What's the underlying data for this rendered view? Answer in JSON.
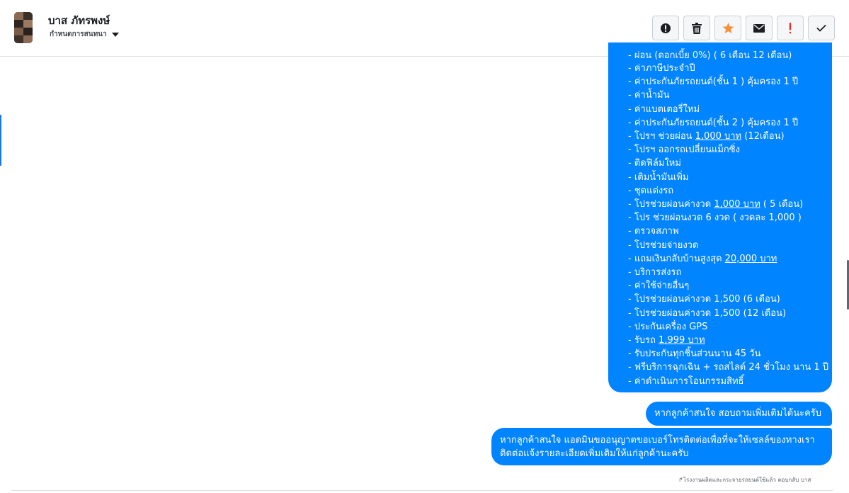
{
  "header": {
    "contact_name": "บาส ภัทรพงษ์",
    "assign_label": "กำหนดการสนทนา"
  },
  "toolbar": [
    {
      "name": "alert-circle-icon",
      "color": "#1c1e21"
    },
    {
      "name": "trash-icon",
      "color": "#1c1e21"
    },
    {
      "name": "star-icon",
      "color": "#f7923b"
    },
    {
      "name": "envelope-icon",
      "color": "#1c1e21"
    },
    {
      "name": "exclamation-icon",
      "color": "#e02e2e"
    },
    {
      "name": "check-icon",
      "color": "#1c1e21"
    }
  ],
  "message1": {
    "cut_line": "- ผ่อน (ดอกเบี้ย 0%) ( 6 เดือน 12 เดือน)",
    "items": [
      {
        "pre": "- ค่าภาษีประจำปี"
      },
      {
        "pre": "- ค่าประกันภัยรถยนต์(ชั้น 1 ) คุ้มครอง 1 ปี"
      },
      {
        "pre": "- ค่าน้ำมัน"
      },
      {
        "pre": "- ค่าแบตเตอรี่ใหม่"
      },
      {
        "pre": "- ค่าประกันภัยรถยนต์(ชั้น 2 ) คุ้มครอง 1 ปี"
      },
      {
        "pre": "- โปรฯ ช่วยผ่อน ",
        "link": "1,000 บาท",
        "post": " (12เดือน)"
      },
      {
        "pre": "- โปรฯ ออกรถเปลี่ยนแม็กซิ่ง"
      },
      {
        "pre": "- ติดฟิล์มใหม่"
      },
      {
        "pre": "- เติมน้ำมันเพิ่ม"
      },
      {
        "pre": "- ชุดแต่งรถ"
      },
      {
        "pre": "- โปรช่วยผ่อนค่างวด ",
        "link": "1,000 บาท",
        "post": " ( 5 เดือน)"
      },
      {
        "pre": "- โปร ช่วยผ่อนงวด 6 งวด ( งวดละ 1,000 )"
      },
      {
        "pre": "- ตรวจสภาพ"
      },
      {
        "pre": "- โปรช่วยจ่ายงวด"
      },
      {
        "pre": "- แถมเงินกลับบ้านสูงสุด ",
        "link": "20,000 บาท"
      },
      {
        "pre": "- บริการส่งรถ"
      },
      {
        "pre": "- ค่าใช้จ่ายอื่นๆ"
      },
      {
        "pre": "- โปรช่วยผ่อนค่างวด 1,500 (6 เดือน)"
      },
      {
        "pre": "- โปรช่วยผ่อนค่างวด 1,500 (12 เดือน)"
      },
      {
        "pre": "- ประกันเครื่อง GPS"
      },
      {
        "pre": "- รับรถ ",
        "link": "1,999 บาท"
      },
      {
        "pre": "- รับประกันทุกชิ้นส่วนนาน 45 วัน"
      },
      {
        "pre": "- ฟรีบริการฉุกเฉิน + รถสไลด์ 24 ชั่วโมง นาน 1 ปี"
      },
      {
        "pre": "- ค่าดำเนินการโอนกรรมสิทธิ์"
      }
    ]
  },
  "message2": "หากลูกค้าสนใจ สอบถามเพิ่มเติมได้นะครับ",
  "message3": {
    "line1": "หากลูกค้าสนใจ แอดมินขออนุญาตขอเบอร์โทรติดต่อเพื่อที่จะให้เซลล์ของทางเรา",
    "line2": "ติดต่อแจ้งรายละเอียดเพิ่มเติมให้แก่ลูกค้านะครับ"
  },
  "attribution": "โรงงานผลิตและกระจายรถยนต์ใช้แล้ว ตอบกลับ บาส",
  "colors": {
    "bubble": "#0084ff",
    "accent": "#1877f2"
  }
}
